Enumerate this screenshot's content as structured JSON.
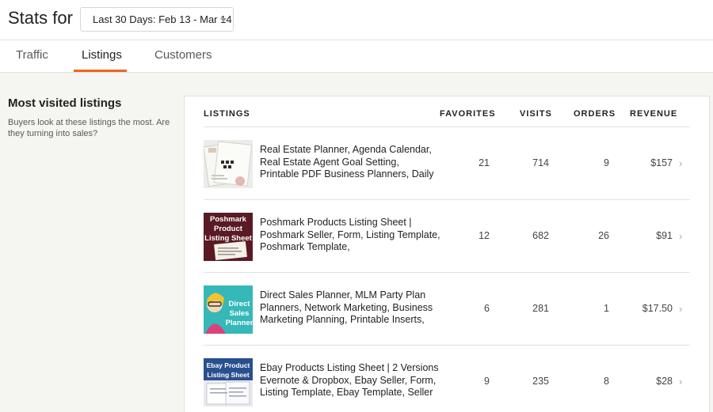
{
  "header": {
    "title": "Stats for",
    "date_range": "Last 30 Days: Feb 13 - Mar 14"
  },
  "tabs": [
    {
      "label": "Traffic",
      "active": false
    },
    {
      "label": "Listings",
      "active": true
    },
    {
      "label": "Customers",
      "active": false
    }
  ],
  "sidebar": {
    "heading": "Most visited listings",
    "description": "Buyers look at these listings the most. Are they turning into sales?"
  },
  "table": {
    "headers": {
      "listings": "LISTINGS",
      "favorites": "FAVORITES",
      "visits": "VISITS",
      "orders": "ORDERS",
      "revenue": "REVENUE"
    },
    "rows": [
      {
        "title": "Real Estate Planner, Agenda Calendar, Real Estate Agent Goal Setting, Printable PDF Business Planners, Daily",
        "favorites": "21",
        "visits": "714",
        "orders": "9",
        "revenue": "$157"
      },
      {
        "title": "Poshmark Products Listing Sheet | Poshmark Seller, Form, Listing Template, Poshmark Template,",
        "favorites": "12",
        "visits": "682",
        "orders": "26",
        "revenue": "$91",
        "thumb_text": [
          "Poshmark",
          "Product",
          "Listing Sheet"
        ]
      },
      {
        "title": "Direct Sales Planner, MLM Party Plan Planners, Network Marketing, Business Marketing Planning, Printable Inserts,",
        "favorites": "6",
        "visits": "281",
        "orders": "1",
        "revenue": "$17.50",
        "thumb_text": [
          "Direct",
          "Sales",
          "Planner"
        ]
      },
      {
        "title": "Ebay Products Listing Sheet | 2 Versions Evernote & Dropbox, Ebay Seller, Form, Listing Template, Ebay Template, Seller",
        "favorites": "9",
        "visits": "235",
        "orders": "8",
        "revenue": "$28",
        "thumb_text": [
          "Ebay Product",
          "Listing Sheet"
        ]
      }
    ]
  },
  "colors": {
    "accent": "#f1641e",
    "posh_bg": "#5a1a24",
    "mlm_bg": "#35b8b8",
    "ebay_bg": "#2a4f8f"
  }
}
